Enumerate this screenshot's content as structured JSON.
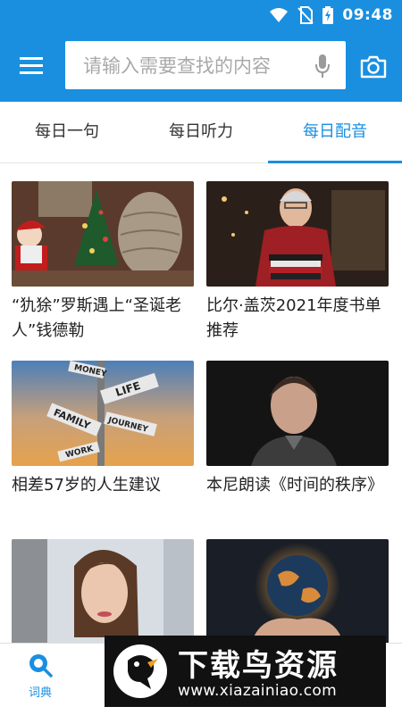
{
  "status_bar": {
    "time": "09:48",
    "icons": [
      "wifi-icon",
      "no-sim-icon",
      "battery-charging-icon"
    ]
  },
  "app_bar": {
    "menu_icon": "hamburger-menu-icon",
    "search": {
      "placeholder": "请输入需要查找的内容",
      "value": ""
    },
    "mic_icon": "microphone-icon",
    "camera_icon": "camera-icon"
  },
  "tabs": [
    {
      "label": "每日一句",
      "active": false
    },
    {
      "label": "每日听力",
      "active": false
    },
    {
      "label": "每日配音",
      "active": true
    }
  ],
  "cards": [
    {
      "title": "“犰狳”罗斯遇上“圣诞老人”钱德勒",
      "image": "christmas-armadillo-santa-photo"
    },
    {
      "title": "比尔·盖茨2021年度书单推荐",
      "image": "bill-gates-holding-books-photo"
    },
    {
      "title": "相差57岁的人生建议",
      "image": "signpost-life-family-journey-photo"
    },
    {
      "title": "本尼朗读《时间的秩序》",
      "image": "benedict-portrait-photo"
    },
    {
      "title": "",
      "image": "woman-portrait-photo"
    },
    {
      "title": "",
      "image": "hands-holding-glowing-earth-photo"
    }
  ],
  "signpost_words": [
    "MONEY",
    "LIFE",
    "FAMILY",
    "JOURNEY",
    "WORK"
  ],
  "bottom_nav": {
    "items": [
      {
        "label": "词典",
        "icon": "search-icon",
        "active": true
      }
    ]
  },
  "watermark": {
    "title": "下载鸟资源",
    "url": "www.xiazainiao.com"
  },
  "colors": {
    "primary": "#1a8fe0",
    "text": "#222222",
    "watermark_bg": "#111111"
  }
}
